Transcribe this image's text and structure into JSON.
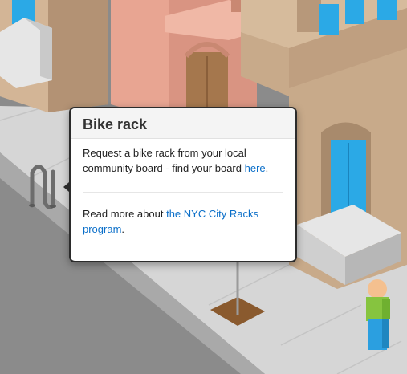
{
  "popover": {
    "title": "Bike rack",
    "text1": "Request a bike rack from your local community board - find your board ",
    "link1": "here",
    "text1_end": ".",
    "text2": "Read more about ",
    "link2": "the NYC City Racks program",
    "text2_end": "."
  },
  "colors": {
    "building_left": "#c2a486",
    "building_pink": "#e39b88",
    "building_right": "#c8aa8a",
    "door_blue": "#2ba9e6",
    "door_brown": "#a5774d",
    "sidewalk": "#d9d9d9",
    "street": "#8a8a8a",
    "tree_pit": "#8a5a2e",
    "person_shirt": "#86c43f",
    "person_pants": "#2b9fe0",
    "person_head": "#f4c08f"
  }
}
